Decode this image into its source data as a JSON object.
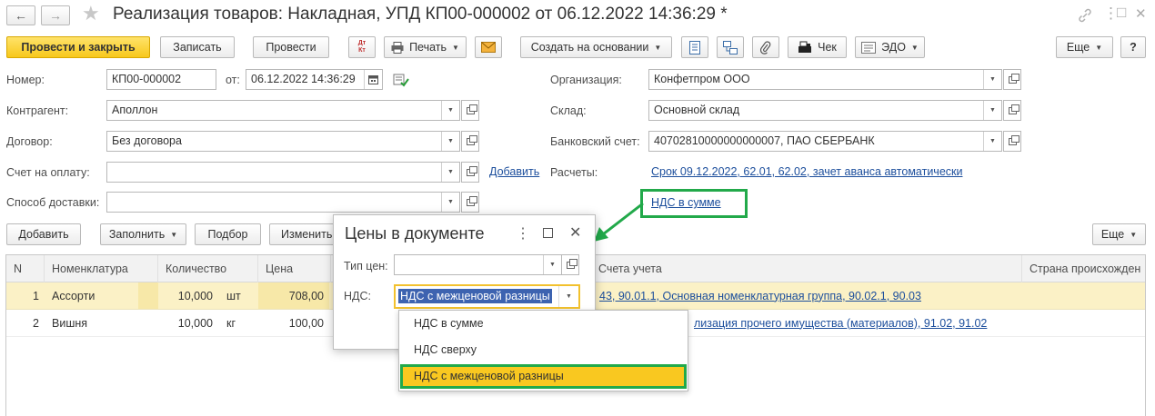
{
  "window": {
    "title": "Реализация товаров: Накладная, УПД КП00-000002 от 06.12.2022 14:36:29 *",
    "nav_back": "←",
    "nav_forward": "→",
    "star": "★",
    "link_icon": "link-icon",
    "menu_icon": "⋮",
    "maximize_icon": "□",
    "close_icon": "✕"
  },
  "toolbar": {
    "post_close": "Провести и закрыть",
    "save": "Записать",
    "post": "Провести",
    "dt_kt": "Дт Кт",
    "print": "Печать",
    "create_basis": "Создать на основании",
    "check": "Чек",
    "edo": "ЭДО",
    "more": "Еще",
    "help": "?"
  },
  "form": {
    "number_label": "Номер:",
    "number_value": "КП00-000002",
    "from_label": "от:",
    "date_value": "06.12.2022 14:36:29",
    "counterparty_label": "Контрагент:",
    "counterparty_value": "Аполлон",
    "contract_label": "Договор:",
    "contract_value": "Без договора",
    "invoice_label": "Счет на оплату:",
    "invoice_value": "",
    "add_link": "Добавить",
    "delivery_label": "Способ доставки:",
    "delivery_value": "",
    "org_label": "Организация:",
    "org_value": "Конфетпром ООО",
    "warehouse_label": "Склад:",
    "warehouse_value": "Основной склад",
    "bank_label": "Банковский счет:",
    "bank_value": "40702810000000000007, ПАО СБЕРБАНК",
    "settlements_label": "Расчеты:",
    "settlements_link": "Срок 09.12.2022, 62.01, 62.02, зачет аванса автоматически",
    "vat_link": "НДС в сумме"
  },
  "table_toolbar": {
    "add": "Добавить",
    "fill": "Заполнить",
    "selection": "Подбор",
    "change": "Изменить",
    "more": "Еще"
  },
  "table": {
    "headers": {
      "n": "N",
      "item": "Номенклатура",
      "qty": "Количество",
      "price": "Цена",
      "accounts": "Счета учета",
      "country": "Страна происхожден"
    },
    "rows": [
      {
        "n": "1",
        "item": "Ассорти",
        "qty": "10,000",
        "unit": "шт",
        "price": "708,00",
        "accounts": "43, 90.01.1, Основная номенклатурная группа, 90.02.1, 90.03"
      },
      {
        "n": "2",
        "item": "Вишня",
        "qty": "10,000",
        "unit": "кг",
        "price": "100,00",
        "accounts": "лизация прочего имущества (материалов), 91.02, 91.02"
      }
    ]
  },
  "dialog": {
    "title": "Цены в документе",
    "price_type_label": "Тип цен:",
    "price_type_value": "",
    "vat_label": "НДС:",
    "vat_value": "НДС с межценовой разницы",
    "options": [
      "НДС в сумме",
      "НДС сверху",
      "НДС с межценовой разницы"
    ]
  },
  "colors": {
    "primary": "#f7c81b",
    "highlight_green": "#22a94a",
    "link": "#1c4e9c",
    "selected_row": "#fbf1c6"
  }
}
